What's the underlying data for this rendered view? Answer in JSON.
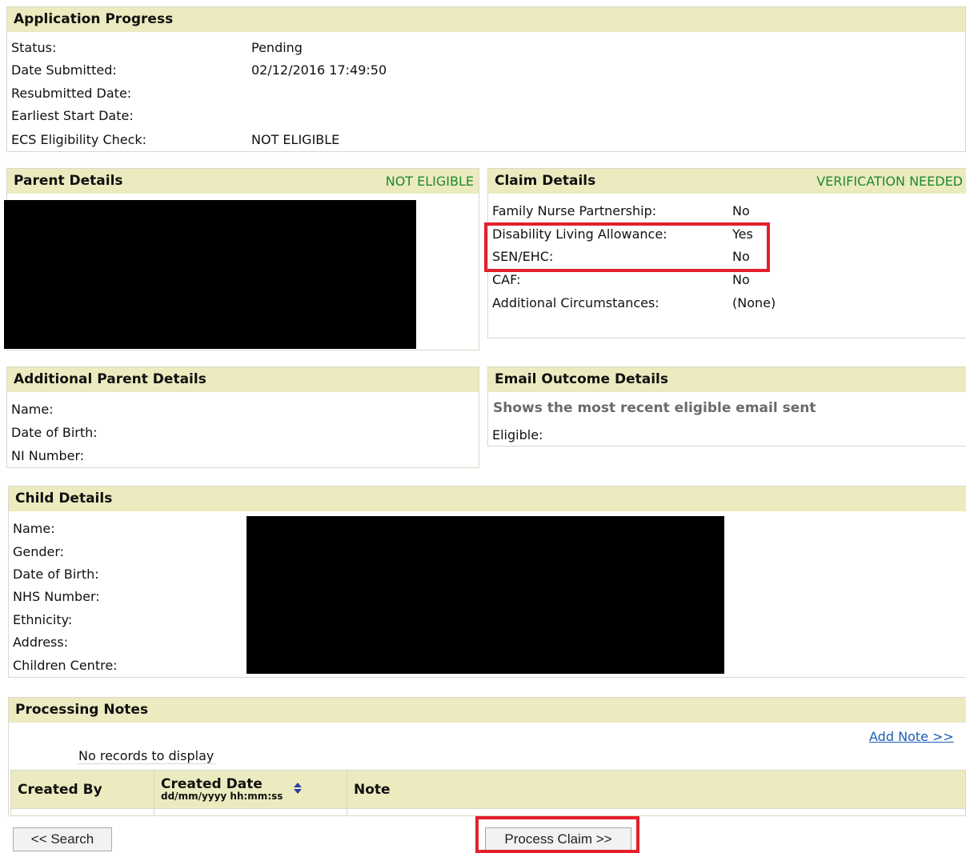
{
  "application_progress": {
    "title": "Application Progress",
    "rows": [
      {
        "label": "Status:",
        "value": "Pending"
      },
      {
        "label": "Date Submitted:",
        "value": "02/12/2016 17:49:50"
      },
      {
        "label": "Resubmitted Date:",
        "value": ""
      },
      {
        "label": "Earliest Start Date:",
        "value": ""
      },
      {
        "label": "ECS Eligibility Check:",
        "value": "NOT ELIGIBLE"
      }
    ]
  },
  "parent_details": {
    "title": "Parent Details",
    "status": "NOT ELIGIBLE"
  },
  "claim_details": {
    "title": "Claim Details",
    "status": "VERIFICATION NEEDED",
    "rows": [
      {
        "label": "Family Nurse Partnership:",
        "value": "No"
      },
      {
        "label": "Disability Living Allowance:",
        "value": "Yes"
      },
      {
        "label": "SEN/EHC:",
        "value": "No"
      },
      {
        "label": "CAF:",
        "value": "No"
      },
      {
        "label": "Additional Circumstances:",
        "value": "(None)"
      }
    ]
  },
  "additional_parent": {
    "title": "Additional Parent Details",
    "rows": [
      {
        "label": "Name:"
      },
      {
        "label": "Date of Birth:"
      },
      {
        "label": "NI Number:"
      }
    ]
  },
  "email_outcome": {
    "title": "Email Outcome Details",
    "subtitle": "Shows the most recent eligible email sent",
    "eligible_label": "Eligible:"
  },
  "child_details": {
    "title": "Child Details",
    "rows": [
      {
        "label": "Name:"
      },
      {
        "label": "Gender:"
      },
      {
        "label": "Date of Birth:"
      },
      {
        "label": "NHS Number:"
      },
      {
        "label": "Ethnicity:"
      },
      {
        "label": "Address:"
      },
      {
        "label": "Children Centre:"
      }
    ]
  },
  "processing_notes": {
    "title": "Processing Notes",
    "add_note": "Add Note >>",
    "empty": "No records to display",
    "columns": {
      "created_by": "Created By",
      "created_date": "Created Date",
      "created_date_format": "dd/mm/yyyy hh:mm:ss",
      "note": "Note"
    }
  },
  "buttons": {
    "search": "<< Search",
    "process": "Process Claim >>"
  },
  "colors": {
    "header_bg": "#ecebc0",
    "status_green": "#1d8a2a",
    "highlight_red": "#e3202b",
    "link_blue": "#1a5db8"
  }
}
